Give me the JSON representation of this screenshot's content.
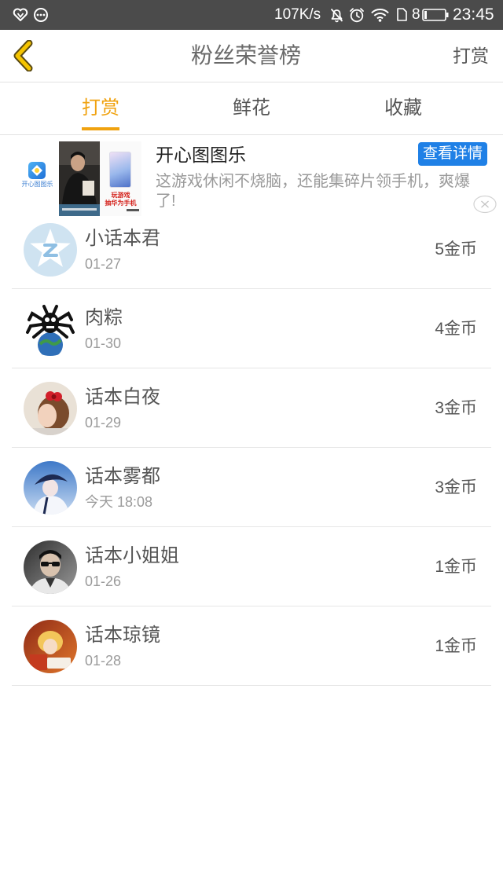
{
  "status_bar": {
    "network_speed": "107K/s",
    "indicator_number": "8",
    "time": "23:45",
    "icons": [
      "notification-heart-icon",
      "message-dots-icon",
      "mute-icon",
      "alarm-icon",
      "wifi-icon",
      "sim-card-icon",
      "battery-icon"
    ]
  },
  "header": {
    "back_icon": "back-chevron-icon",
    "title": "粉丝荣誉榜",
    "right_action": "打赏"
  },
  "tabs": [
    {
      "label": "打赏",
      "active": true
    },
    {
      "label": "鲜花",
      "active": false
    },
    {
      "label": "收藏",
      "active": false
    }
  ],
  "ad": {
    "title": "开心图图乐",
    "button_label": "查看详情",
    "description": "这游戏休闲不烧脑，还能集碎片领手机，爽爆了!",
    "close_icon": "close-circle-icon",
    "image": {
      "logo_text": "开心图图乐",
      "promo_line_1": "玩游戏",
      "promo_line_2": "抽华为手机"
    }
  },
  "fans": [
    {
      "name": "小话本君",
      "date": "01-27",
      "amount": "5金币"
    },
    {
      "name": "肉粽",
      "date": "01-30",
      "amount": "4金币"
    },
    {
      "name": "话本白夜",
      "date": "01-29",
      "amount": "3金币"
    },
    {
      "name": "话本雾都",
      "date": "今天 18:08",
      "amount": "3金币"
    },
    {
      "name": "话本小姐姐",
      "date": "01-26",
      "amount": "1金币"
    },
    {
      "name": "话本琼镜",
      "date": "01-28",
      "amount": "1金币"
    }
  ],
  "colors": {
    "accent": "#f0a20f",
    "ad_button": "#1f80e6",
    "status_bar": "#4b4b4b"
  }
}
